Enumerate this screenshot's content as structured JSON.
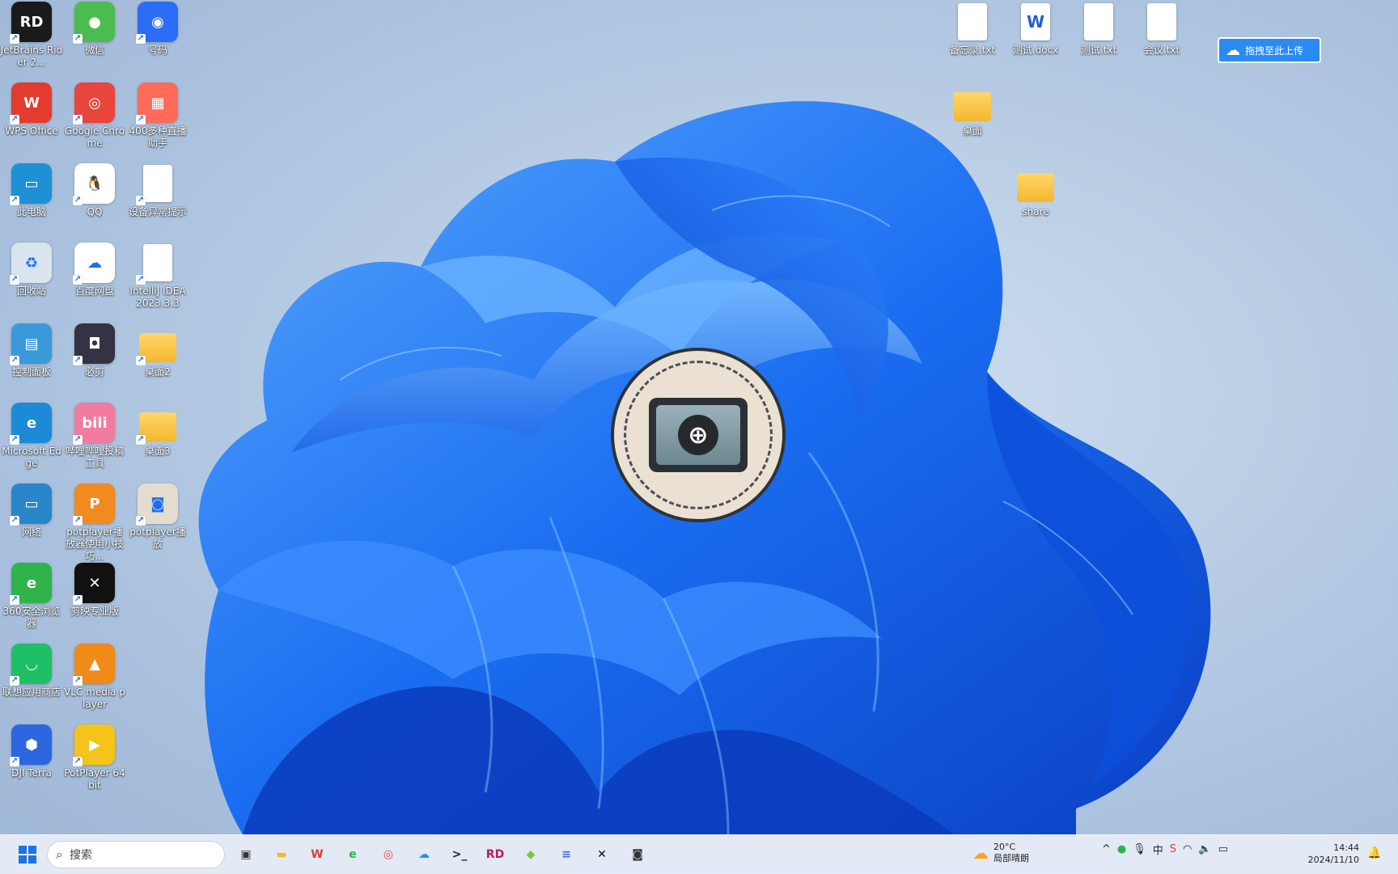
{
  "desktop": {
    "left_icons": [
      {
        "label": "JetBrains Rider 2...",
        "icon": "rider-icon",
        "color": "#1a1a1a",
        "glyph": "RD"
      },
      {
        "label": "微信",
        "icon": "wechat-icon",
        "color": "#4bbd4f",
        "glyph": "●"
      },
      {
        "label": "号码",
        "icon": "circle-app-icon",
        "color": "#2d6cf5",
        "glyph": "◉"
      },
      {
        "label": "WPS Office",
        "icon": "wps-icon",
        "color": "#e33b2e",
        "glyph": "W"
      },
      {
        "label": "Google Chrome",
        "icon": "chrome-icon",
        "color": "#e8453c",
        "glyph": "◎"
      },
      {
        "label": "400多种直播助手",
        "icon": "live-helper-icon",
        "color": "#ff6b5a",
        "glyph": "▦"
      },
      {
        "label": "此电脑",
        "icon": "this-pc-icon",
        "color": "#1e90d6",
        "glyph": "▭"
      },
      {
        "label": "QQ",
        "icon": "qq-icon",
        "color": "#ffffff",
        "glyph": "🐧"
      },
      {
        "label": "设备异常提示",
        "icon": "file-icon",
        "color": "#ffffff",
        "glyph": ""
      },
      {
        "label": "回收站",
        "icon": "recycle-bin-icon",
        "color": "#d8e4ee",
        "glyph": "♻"
      },
      {
        "label": "百度网盘",
        "icon": "baidu-netdisk-icon",
        "color": "#ffffff",
        "glyph": "☁"
      },
      {
        "label": "IntelliJ IDEA 2023.3.3",
        "icon": "file-icon",
        "color": "#ffffff",
        "glyph": ""
      },
      {
        "label": "控制面板",
        "icon": "control-panel-icon",
        "color": "#3a9ad9",
        "glyph": "▤"
      },
      {
        "label": "必剪",
        "icon": "bijian-icon",
        "color": "#333344",
        "glyph": "◘"
      },
      {
        "label": "桌面2",
        "icon": "folder-icon",
        "color": "#f4b72f",
        "glyph": ""
      },
      {
        "label": "Microsoft Edge",
        "icon": "edge-icon",
        "color": "#1c8ad6",
        "glyph": "e"
      },
      {
        "label": "哔哩哔哩投稿工具",
        "icon": "bilibili-icon",
        "color": "#f27ba0",
        "glyph": "bili"
      },
      {
        "label": "桌面3",
        "icon": "folder-icon",
        "color": "#f4b72f",
        "glyph": ""
      },
      {
        "label": "网络",
        "icon": "network-icon",
        "color": "#2a86c9",
        "glyph": "▭"
      },
      {
        "label": "potplayer播放器使用小技巧...",
        "icon": "ppt-icon",
        "color": "#f18a1f",
        "glyph": "P"
      },
      {
        "label": "potplayer播放",
        "icon": "screen-logo-icon",
        "color": "#e4dccf",
        "glyph": "◙"
      },
      {
        "label": "360安全浏览器",
        "icon": "360-browser-icon",
        "color": "#2fb34a",
        "glyph": "e"
      },
      {
        "label": "剪映专业版",
        "icon": "capcut-icon",
        "color": "#111111",
        "glyph": "✕"
      },
      {
        "label": "",
        "icon": "",
        "color": "",
        "glyph": ""
      },
      {
        "label": "联想应用商店",
        "icon": "lenovo-store-icon",
        "color": "#1fbf66",
        "glyph": "◡"
      },
      {
        "label": "VLC media player",
        "icon": "vlc-icon",
        "color": "#f08a18",
        "glyph": "▲"
      },
      {
        "label": "",
        "icon": "",
        "color": "",
        "glyph": ""
      },
      {
        "label": "DJI Terra",
        "icon": "dji-terra-icon",
        "color": "#2d67e0",
        "glyph": "⬢"
      },
      {
        "label": "PotPlayer 64 bit",
        "icon": "potplayer-icon",
        "color": "#f5c41a",
        "glyph": "▶"
      }
    ],
    "right_icons": [
      {
        "label": "备忘录.txt",
        "icon": "text-file-icon",
        "kind": "file"
      },
      {
        "label": "测试.docx",
        "icon": "word-doc-icon",
        "kind": "word"
      },
      {
        "label": "测试.txt",
        "icon": "text-file-icon",
        "kind": "file"
      },
      {
        "label": "会议.txt",
        "icon": "text-file-icon",
        "kind": "file"
      },
      {
        "label": "桌面",
        "icon": "folder-icon",
        "kind": "folder"
      },
      {
        "label": "share",
        "icon": "folder-icon",
        "kind": "folder"
      }
    ],
    "upload_button": {
      "label": "拖拽至此上传",
      "icon": "baidu-netdisk-icon"
    }
  },
  "taskbar": {
    "search_placeholder": "搜索",
    "apps": [
      {
        "name": "task-view-icon",
        "glyph": "▣",
        "color": "#333333"
      },
      {
        "name": "file-explorer-icon",
        "glyph": "▬",
        "color": "#f4b72f"
      },
      {
        "name": "wps-icon",
        "glyph": "W",
        "color": "#e33b2e"
      },
      {
        "name": "360-browser-icon",
        "glyph": "e",
        "color": "#2fb34a"
      },
      {
        "name": "chrome-icon",
        "glyph": "◎",
        "color": "#e8453c"
      },
      {
        "name": "baidu-netdisk-icon",
        "glyph": "☁",
        "color": "#2a8bf7"
      },
      {
        "name": "terminal-icon",
        "glyph": ">_",
        "color": "#222222"
      },
      {
        "name": "rider-icon",
        "glyph": "RD",
        "color": "#c2185b"
      },
      {
        "name": "colorful-app-icon",
        "glyph": "◆",
        "color": "#7cc24a"
      },
      {
        "name": "layers-app-icon",
        "glyph": "≡",
        "color": "#3b6fd4"
      },
      {
        "name": "capcut-icon",
        "glyph": "✕",
        "color": "#111111"
      },
      {
        "name": "screen-logo-icon",
        "glyph": "◙",
        "color": "#333333"
      }
    ],
    "weather": {
      "temp": "20°C",
      "desc": "局部晴朗"
    },
    "tray": {
      "ime": "中",
      "chevron": "^"
    },
    "clock": {
      "time": "14:44",
      "date": "2024/11/10"
    }
  }
}
